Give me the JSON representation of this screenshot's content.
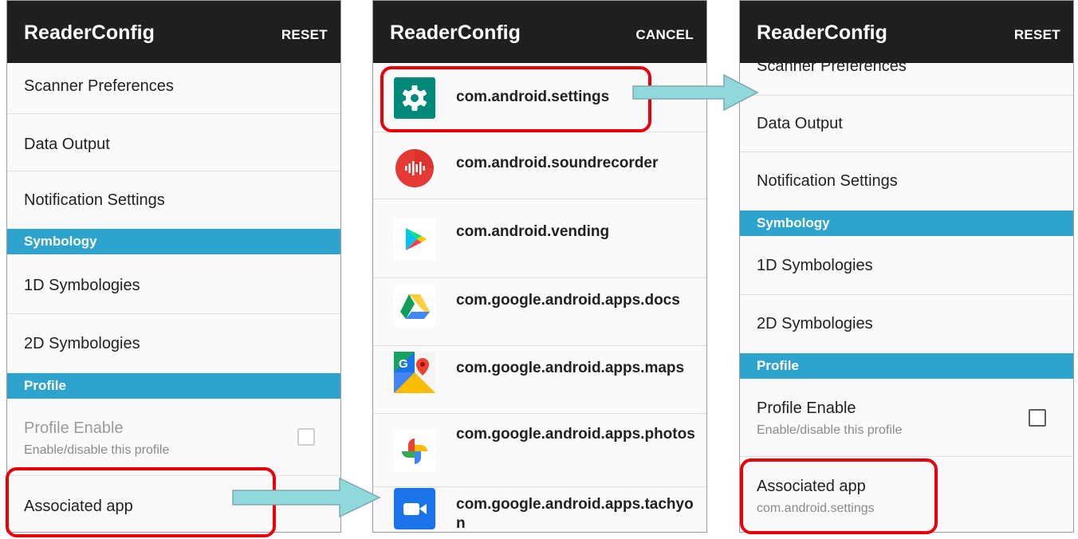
{
  "colors": {
    "appbar": "#1f1f1f",
    "section": "#2ea3cd",
    "highlight": "#e8000a",
    "arrow": "#8fd8dc"
  },
  "screen1": {
    "title": "ReaderConfig",
    "action": "RESET",
    "items": {
      "scanner": "Scanner Preferences",
      "data_output": "Data Output",
      "notification": "Notification Settings",
      "symbology_header": "Symbology",
      "sym_1d": "1D Symbologies",
      "sym_2d": "2D Symbologies",
      "profile_header": "Profile",
      "profile_enable": "Profile Enable",
      "profile_enable_sub": "Enable/disable this profile",
      "associated_app": "Associated app"
    }
  },
  "screen2": {
    "title": "ReaderConfig",
    "action": "CANCEL",
    "apps": [
      {
        "package": "com.android.settings",
        "icon": "settings-icon"
      },
      {
        "package": "com.android.soundrecorder",
        "icon": "sound-recorder-icon"
      },
      {
        "package": "com.android.vending",
        "icon": "play-store-icon"
      },
      {
        "package": "com.google.android.apps.docs",
        "icon": "drive-icon"
      },
      {
        "package": "com.google.android.apps.maps",
        "icon": "maps-icon"
      },
      {
        "package": "com.google.android.apps.photos",
        "icon": "photos-icon"
      },
      {
        "package": "com.google.android.apps.tachyon",
        "icon": "duo-icon"
      }
    ]
  },
  "screen3": {
    "title": "ReaderConfig",
    "action": "RESET",
    "items": {
      "scanner": "Scanner Preferences",
      "data_output": "Data Output",
      "notification": "Notification Settings",
      "symbology_header": "Symbology",
      "sym_1d": "1D Symbologies",
      "sym_2d": "2D Symbologies",
      "profile_header": "Profile",
      "profile_enable": "Profile Enable",
      "profile_enable_sub": "Enable/disable this profile",
      "associated_app": "Associated app",
      "associated_app_value": "com.android.settings"
    }
  }
}
